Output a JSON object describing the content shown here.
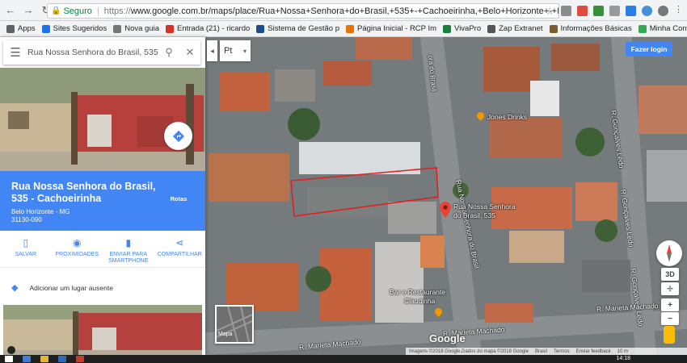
{
  "browser": {
    "secure_label": "Seguro",
    "url_prefix": "https://",
    "url_main": "www.google.com.br/maps/place/Rua+Nossa+Senhora+do+Brasil,+535+-+Cachoeirinha,+Belo+Horizonte+-+MG,+31130-090/@-19.89..."
  },
  "bookmarks": [
    {
      "label": "Apps",
      "color": "#5f6368"
    },
    {
      "label": "Sites Sugeridos",
      "color": "#1a73e8"
    },
    {
      "label": "Nova guia",
      "color": "#777777"
    },
    {
      "label": "Entrada (21) - ricardo",
      "color": "#d93025"
    },
    {
      "label": "Sistema de Gestão p",
      "color": "#1a4d8f"
    },
    {
      "label": "Página Inicial - RCP Im",
      "color": "#e8710a"
    },
    {
      "label": "VivaPro",
      "color": "#188038"
    },
    {
      "label": "Zap Extranet",
      "color": "#555555"
    },
    {
      "label": "Informações Básicas",
      "color": "#7a5c2e"
    },
    {
      "label": "Minha Conta | bom",
      "color": "#34a853"
    }
  ],
  "search": {
    "value": "Rua Nossa Senhora do Brasil, 535"
  },
  "place": {
    "title": "Rua Nossa Senhora do Brasil, 535 - Cachoeirinha",
    "city": "Belo Horizonte - MG",
    "zip": "31130-090",
    "directions_label": "Rotas"
  },
  "actions": [
    {
      "label": "SALVAR",
      "icon": "bookmark-icon"
    },
    {
      "label": "PROXIMIDADES",
      "icon": "nearby-icon"
    },
    {
      "label": "ENVIAR PARA SMARTPHONE",
      "icon": "phone-icon"
    },
    {
      "label": "COMPARTILHAR",
      "icon": "share-icon"
    }
  ],
  "add_place_label": "Adicionar um lugar ausente",
  "map": {
    "language": "Pt",
    "login_label": "Fazer login",
    "pin_label_1": "Rua Nossa Senhora",
    "pin_label_2": "do Brasil, 535",
    "street_vertical_1": "Rua Nossa Senhora do Brasil",
    "street_vertical_top": "ora do Brasil",
    "street_goncalves_1": "R. Gonçalves Lêdo",
    "street_goncalves_2": "R. Gonçalves Lêdo",
    "street_goncalves_3": "R. Gonçalves Lêdo",
    "street_marieta_1": "R. Marieta Machado",
    "street_marieta_2": "R. Marieta Machado",
    "street_marieta_3": "R. Marieta Machado",
    "poi_1": "Jones Drinks",
    "poi_2_line1": "Bar e Restaurante",
    "poi_2_line2": "Claudinha",
    "streetview_label": "Mapa",
    "google_logo": "Google",
    "footer_1": "Imagens ©2018 Google,Dados do mapa ©2018 Google",
    "footer_2": "Brasil",
    "footer_3": "Termos",
    "footer_4": "Enviar feedback",
    "footer_5": "10 m",
    "view_3d": "3D",
    "zoom_in": "+",
    "zoom_out": "−"
  },
  "taskbar": {
    "time": "14:18"
  }
}
